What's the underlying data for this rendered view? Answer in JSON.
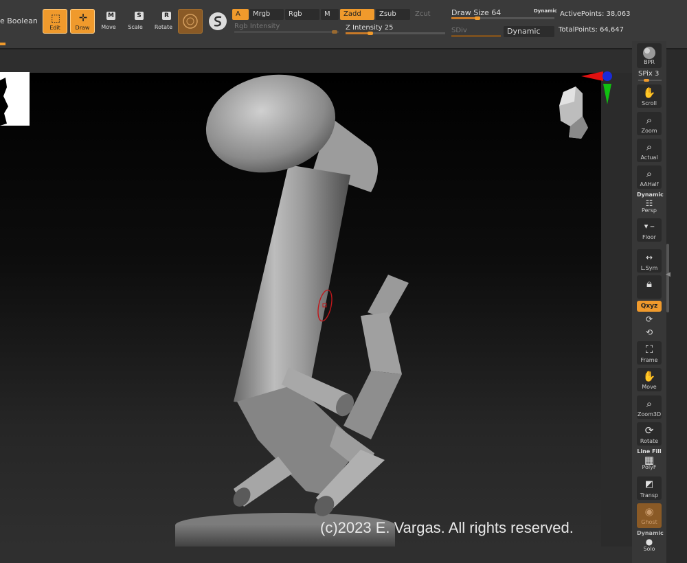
{
  "toolbar": {
    "boolean_label": "e Boolean",
    "edit_label": "Edit",
    "draw_label": "Draw",
    "move_label": "Move",
    "move_key": "M",
    "scale_label": "Scale",
    "scale_key": "S",
    "rotate_label": "Rotate",
    "rotate_key": "R",
    "a_label": "A",
    "mrgb_label": "Mrgb",
    "rgb_label": "Rgb",
    "m_label": "M",
    "zadd_label": "Zadd",
    "zsub_label": "Zsub",
    "zcut_label": "Zcut",
    "rgb_intensity_label": "Rgb Intensity",
    "z_intensity_label": "Z Intensity",
    "z_intensity_value": "25",
    "z_intensity_level": 0.25,
    "draw_size_label": "Draw Size",
    "draw_size_value": "64",
    "draw_size_level": 0.25,
    "dynamic_small": "Dynamic",
    "sdiv_label": "SDiv",
    "dynamic_button": "Dynamic",
    "active_points_label": "ActivePoints:",
    "active_points_value": "38,063",
    "total_points_label": "TotalPoints:",
    "total_points_value": "64,647"
  },
  "shelf": {
    "bpr": "BPR",
    "spix_label": "SPix",
    "spix_value": "3",
    "scroll": "Scroll",
    "zoom": "Zoom",
    "actual": "Actual",
    "aahalf": "AAHalf",
    "dynamic_tag": "Dynamic",
    "persp": "Persp",
    "floor": "Floor",
    "lsym": "L.Sym",
    "xyz": "Qxyz",
    "frame": "Frame",
    "move": "Move",
    "zoom3d": "Zoom3D",
    "rotate": "Rotate",
    "linefill_tag": "Line Fill",
    "polyf": "PolyF",
    "transp": "Transp",
    "ghost": "Ghost",
    "dynamic_tag2": "Dynamic",
    "solo": "Solo"
  },
  "canvas": {
    "copyright": "(c)2023 E. Vargas. All rights reserved."
  },
  "colors": {
    "accent": "#f09a2c",
    "panel": "#3a3a3a",
    "canvas_top": "#000000"
  }
}
